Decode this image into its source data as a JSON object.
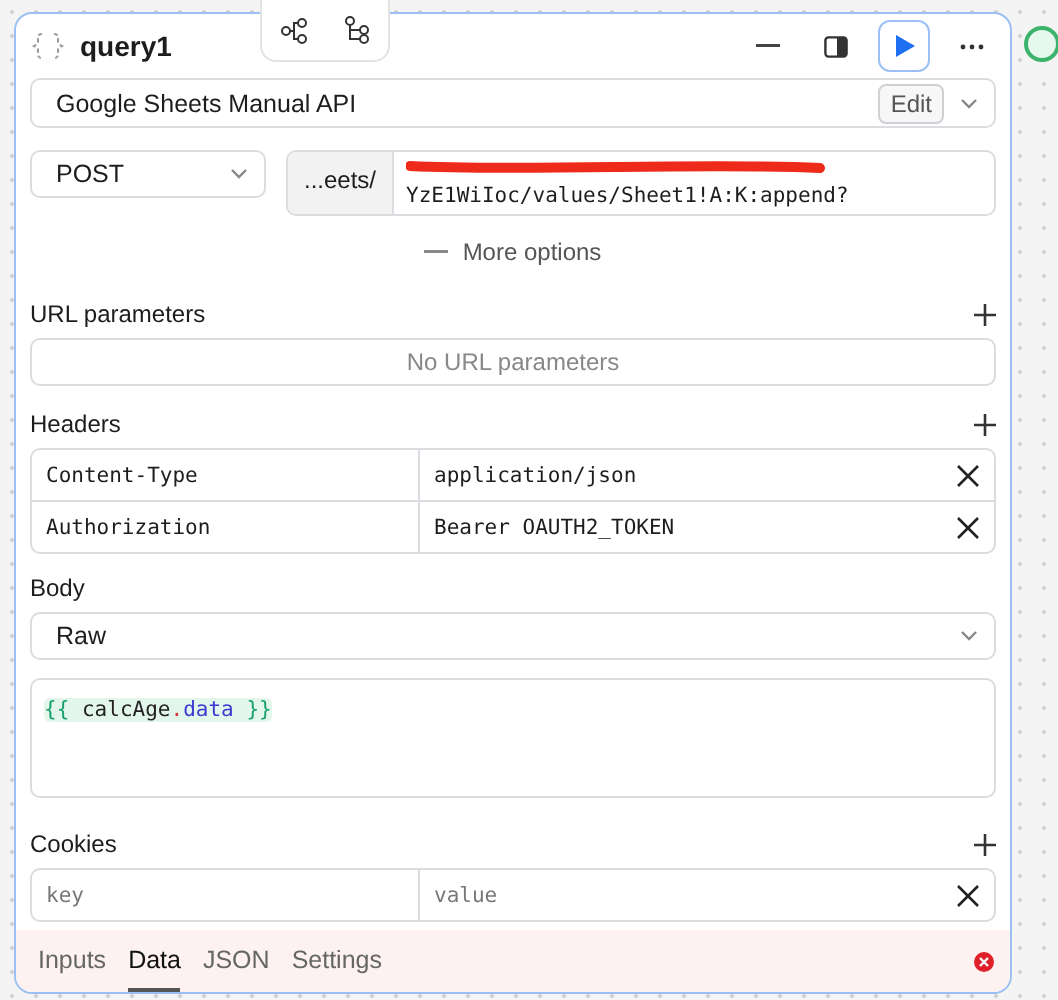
{
  "query": {
    "title": "query1",
    "resource": "Google Sheets Manual API",
    "edit_label": "Edit"
  },
  "request": {
    "method": "POST",
    "url_prefix": "...eets/",
    "url_redacted": true,
    "url_tail": "YzE1WiIoc/values/Sheet1!A:K:append?",
    "more_options": "More options"
  },
  "url_parameters": {
    "title": "URL parameters",
    "empty_text": "No URL parameters"
  },
  "headers": {
    "title": "Headers",
    "rows": [
      {
        "key": "Content-Type",
        "value": "application/json"
      },
      {
        "key": "Authorization",
        "value": "Bearer OAUTH2_TOKEN"
      }
    ]
  },
  "body": {
    "title": "Body",
    "type": "Raw",
    "code": {
      "open": "{{",
      "object": "calcAge",
      "dot": ".",
      "property": "data",
      "close": "}}"
    }
  },
  "cookies": {
    "title": "Cookies",
    "rows": [
      {
        "key_placeholder": "key",
        "value_placeholder": "value"
      }
    ]
  },
  "tabs": [
    {
      "label": "Inputs",
      "selected": false
    },
    {
      "label": "Data",
      "selected": true
    },
    {
      "label": "JSON",
      "selected": false
    },
    {
      "label": "Settings",
      "selected": false
    }
  ],
  "has_error": true
}
